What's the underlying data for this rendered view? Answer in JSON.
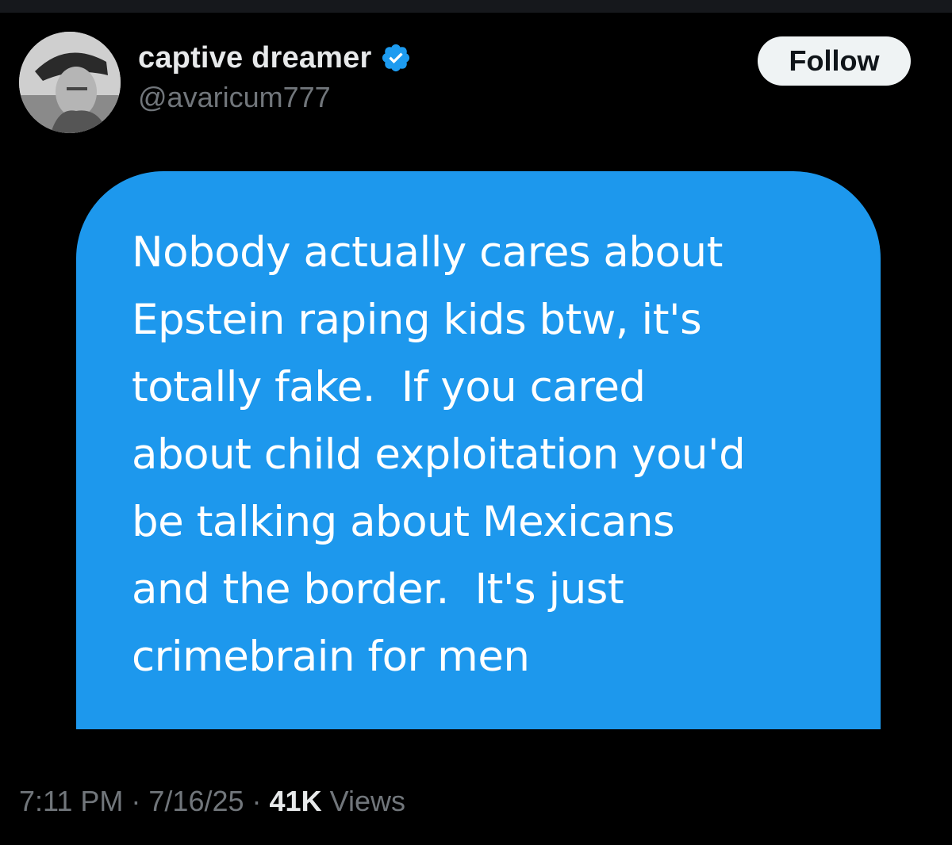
{
  "post": {
    "author": {
      "display_name": "captive dreamer",
      "handle": "@avaricum777",
      "verified": true,
      "avatar_icon": "profile-photo-soldier-beret"
    },
    "follow_label": "Follow",
    "message_text": "Nobody actually cares about\nEpstein raping kids btw, it's\ntotally fake.  If you cared\nabout child exploitation you'd\nbe talking about Mexicans\nand the border.  It's just\ncrimebrain for men",
    "time": "7:11 PM",
    "date": "7/16/25",
    "separator": "·",
    "views_count": "41K",
    "views_label": "Views"
  },
  "colors": {
    "background": "#000000",
    "bubble": "#1d98ed",
    "verified_badge": "#1d9bf0",
    "follow_button_bg": "#eff3f4",
    "muted_text": "#71767b",
    "primary_text": "#e7e9ea"
  }
}
